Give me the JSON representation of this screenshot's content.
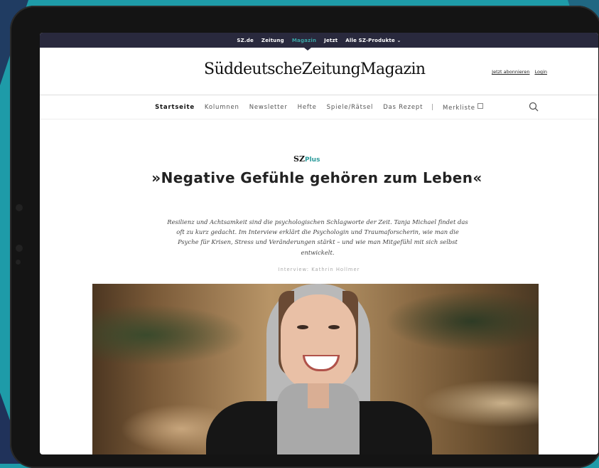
{
  "topbar": {
    "items": [
      {
        "label": "SZ.de"
      },
      {
        "label": "Zeitung"
      },
      {
        "label": "Magazin",
        "active": true
      },
      {
        "label": "Jetzt"
      },
      {
        "label": "Alle SZ-Produkte ⌄"
      }
    ]
  },
  "masthead": {
    "logo": "SüddeutscheZeitungMagazin",
    "subscribe": "Jetzt abonnieren",
    "login": "Login"
  },
  "nav": {
    "items": [
      "Startseite",
      "Kolumnen",
      "Newsletter",
      "Hefte",
      "Spiele/Rätsel",
      "Das Rezept"
    ],
    "separator": "|",
    "bookmarks": "Merkliste"
  },
  "article": {
    "badge_sz": "SZ",
    "badge_plus": "Plus",
    "headline": "»Negative Gefühle gehören zum Leben«",
    "teaser": "Resilienz und Achtsamkeit sind die psychologischen Schlagworte der Zeit. Tanja Michael findet das oft zu kurz gedacht. Im Interview erklärt die Psychologin und Traumaforscherin, wie man die Psyche für Krisen, Stress und Veränderungen stärkt – und wie man Mitgefühl mit sich selbst entwickelt.",
    "byline": "Interview: Kathrin Hollmer"
  },
  "colors": {
    "background": "#1e9ba8",
    "topbar": "#29293d",
    "accent": "#2a9a9a"
  },
  "icons": {
    "search": "search-icon",
    "external": "external-link-icon"
  }
}
